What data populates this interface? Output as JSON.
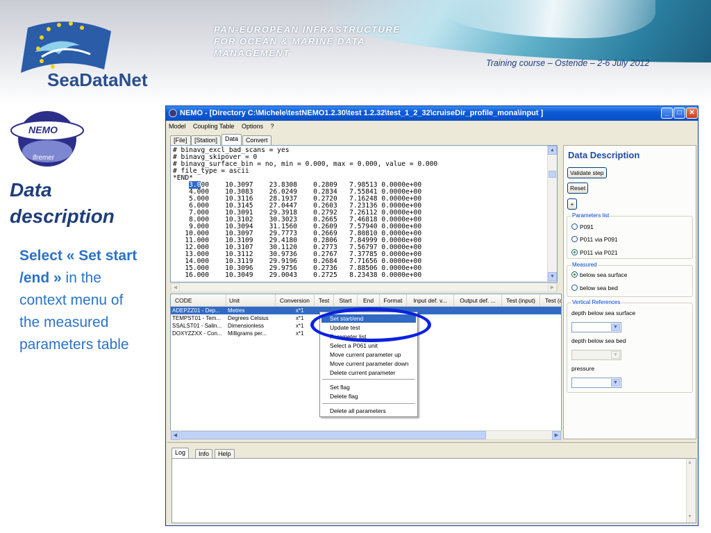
{
  "header": {
    "logo_text": "SeaDataNet",
    "tagline": [
      "PAN-EUROPEAN INFRASTRUCTURE",
      "FOR OCEAN & MARINE DATA",
      "MANAGEMENT"
    ],
    "course": "Training course – Ostende – 2-6 July 2012"
  },
  "left": {
    "nemo_logo_top": "NEMO",
    "nemo_logo_bottom": "ifremer",
    "title_lines": [
      "Data",
      "description"
    ],
    "text_bold": "Select « Set start /end »",
    "text_rest": " in the context menu of the measured parameters table"
  },
  "window": {
    "title": "NEMO - [Directory C:\\Michele\\testNEMO1.2.30\\test 1.2.32\\test_1_2_32\\cruiseDir_profile_mona\\input ]",
    "menu": [
      "Model",
      "Coupling Table",
      "Options",
      "?"
    ],
    "tabs": [
      "[File]",
      "[Station]",
      "Data",
      "Convert"
    ],
    "text_lines": [
      "# binavg_excl_bad_scans = yes",
      "# binavg_skipover = 0",
      "# binavg_surface_bin = no, min = 0.000, max = 0.000, value = 0.000",
      "# file_type = ascii",
      "*END*"
    ],
    "highlight_value": "3.0",
    "data_rows": [
      [
        "3.000",
        "10.3097",
        "23.8308",
        "0.2809",
        "7.98513",
        "0.0000e+00"
      ],
      [
        "4.000",
        "10.3083",
        "26.0249",
        "0.2834",
        "7.55841",
        "0.0000e+00"
      ],
      [
        "5.000",
        "10.3116",
        "28.1937",
        "0.2720",
        "7.16248",
        "0.0000e+00"
      ],
      [
        "6.000",
        "10.3145",
        "27.0447",
        "0.2603",
        "7.23136",
        "0.0000e+00"
      ],
      [
        "7.000",
        "10.3091",
        "29.3918",
        "0.2792",
        "7.26112",
        "0.0000e+00"
      ],
      [
        "8.000",
        "10.3102",
        "30.3023",
        "0.2665",
        "7.46818",
        "0.0000e+00"
      ],
      [
        "9.000",
        "10.3094",
        "31.1560",
        "0.2609",
        "7.57940",
        "0.0000e+00"
      ],
      [
        "10.000",
        "10.3097",
        "29.7773",
        "0.2669",
        "7.80810",
        "0.0000e+00"
      ],
      [
        "11.000",
        "10.3109",
        "29.4180",
        "0.2806",
        "7.84999",
        "0.0000e+00"
      ],
      [
        "12.000",
        "10.3107",
        "30.1120",
        "0.2773",
        "7.56797",
        "0.0000e+00"
      ],
      [
        "13.000",
        "10.3112",
        "30.9736",
        "0.2767",
        "7.37785",
        "0.0000e+00"
      ],
      [
        "14.000",
        "10.3119",
        "29.9196",
        "0.2684",
        "7.71656",
        "0.0000e+00"
      ],
      [
        "15.000",
        "10.3096",
        "29.9756",
        "0.2736",
        "7.88506",
        "0.0000e+00"
      ],
      [
        "16.000",
        "10.3049",
        "29.0043",
        "0.2725",
        "8.23438",
        "0.0000e+00"
      ]
    ],
    "table_headers": [
      "CODE",
      "Unit",
      "Conversion",
      "Test",
      "Start",
      "End",
      "Format",
      "Input def. v...",
      "Output def. ...",
      "Test (input)",
      "Test (c"
    ],
    "table_rows": [
      [
        "ADEPZZ01 - Dep...",
        "Metres",
        "x*1"
      ],
      [
        "TEMPST01 - Tem...",
        "Degrees Celsius",
        "x*1"
      ],
      [
        "SSALST01 - Salin...",
        "Dimensionless",
        "x*1"
      ],
      [
        "DOXYZZXX - Con...",
        "Milligrams per...",
        "x*1"
      ]
    ],
    "context_menu": {
      "group1": [
        "Set start/end",
        "Update test",
        "Parameter list",
        "Select a P061 unit",
        "Move current parameter up",
        "Move current parameter down",
        "Delete current parameter"
      ],
      "group2": [
        "Set flag",
        "Delete flag"
      ],
      "group3": [
        "Delete all parameters"
      ]
    },
    "right_panel": {
      "title": "Data Description",
      "validate_btn": "Validate step",
      "reset_btn": "Reset",
      "plus_btn": "+",
      "params_label": "Parameters list",
      "params": [
        "P091",
        "P011 via P091",
        "P011 via P021"
      ],
      "measured_label": "Measured",
      "measured": [
        "below sea surface",
        "below sea bed"
      ],
      "vertical_label": "Vertical References",
      "depth_surface": "depth below sea surface",
      "depth_bed": "depth below sea bed",
      "pressure": "pressure"
    },
    "log_tabs": [
      "Log",
      "Info",
      "Help"
    ]
  }
}
